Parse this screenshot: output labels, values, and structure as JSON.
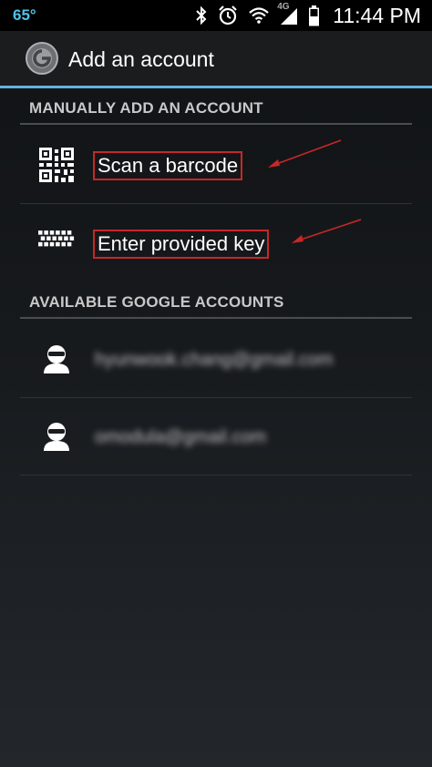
{
  "status_bar": {
    "temperature": "65°",
    "network": "4G",
    "time": "11:44 PM",
    "icons": [
      "bluetooth-icon",
      "alarm-icon",
      "wifi-icon",
      "signal-icon",
      "battery-icon"
    ]
  },
  "action_bar": {
    "title": "Add an account",
    "app_icon": "authenticator-icon",
    "accent_color": "#5fb4dc"
  },
  "manual_section": {
    "header": "MANUALLY ADD AN ACCOUNT",
    "items": [
      {
        "label": "Scan a barcode",
        "icon": "qr-code-icon"
      },
      {
        "label": "Enter provided key",
        "icon": "keyboard-icon"
      }
    ]
  },
  "google_section": {
    "header": "AVAILABLE GOOGLE ACCOUNTS",
    "accounts": [
      {
        "label": "hyunwook.chang@gmail.com",
        "icon": "person-icon"
      },
      {
        "label": "omodula@gmail.com",
        "icon": "person-icon"
      }
    ]
  },
  "annotation": {
    "highlight_color": "#c62828"
  }
}
